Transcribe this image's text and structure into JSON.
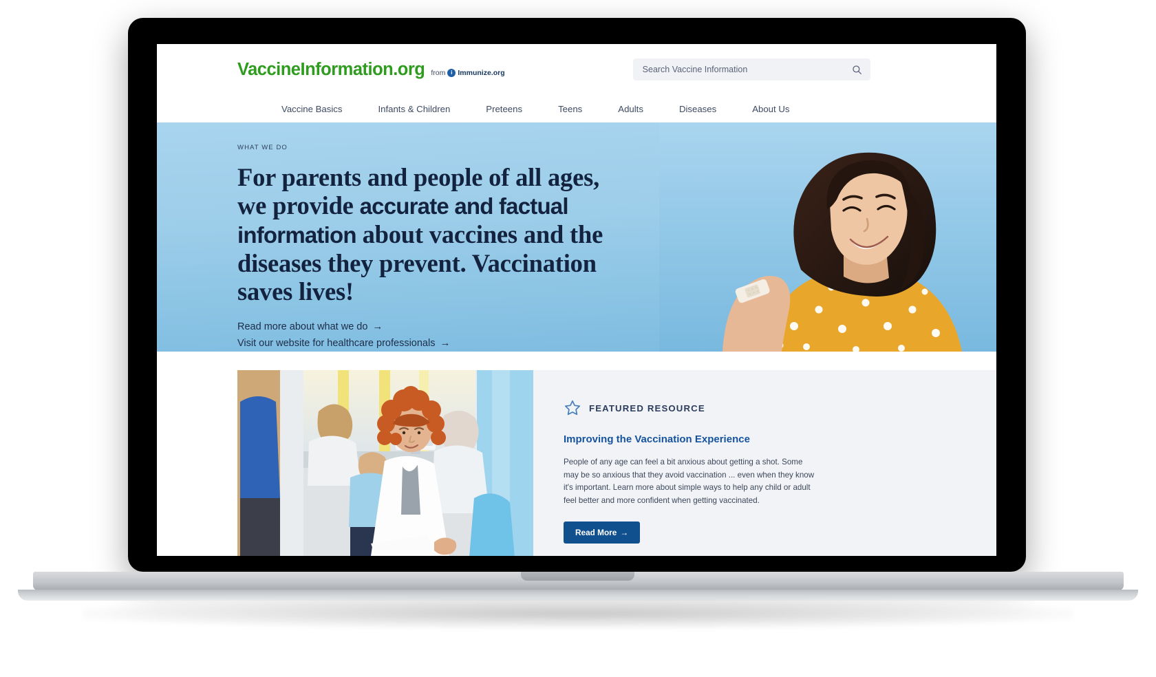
{
  "header": {
    "brand_name": "VaccineInformation.org",
    "from_label": "from",
    "immunize_mark": "i",
    "immunize_name": "Immunize.org",
    "search_placeholder": "Search Vaccine Information",
    "search_value": "",
    "search_icon": "search-icon"
  },
  "nav": {
    "items": [
      {
        "label": "Vaccine Basics"
      },
      {
        "label": "Infants & Children"
      },
      {
        "label": "Preteens"
      },
      {
        "label": "Teens"
      },
      {
        "label": "Adults"
      },
      {
        "label": "Diseases"
      },
      {
        "label": "About Us"
      }
    ]
  },
  "hero": {
    "eyebrow": "WHAT WE DO",
    "head_part1": "For parents and people of all ages, we provide ",
    "head_bold": "accurate and factual information",
    "head_part2": " about vaccines and the diseases they prevent. Vaccination saves lives!",
    "links": [
      {
        "label": "Read more about what we do",
        "arrow": "→"
      },
      {
        "label": "Visit our website for healthcare professionals",
        "arrow": "→"
      }
    ],
    "image_alt": "Smiling woman in orange polka-dot top with bandage on her upper arm",
    "bg_color": "#9ccde9"
  },
  "featured": {
    "kicker": "FEATURED RESOURCE",
    "kicker_icon": "star-outline-icon",
    "title": "Improving the Vaccination Experience",
    "description": "People of any age can feel a bit anxious about getting a shot. Some may be so anxious that they avoid vaccination ... even when they know it's important. Learn more about simple ways to help any child or adult feel better and more confident when getting vaccinated.",
    "button_label": "Read More",
    "button_arrow": "→",
    "button_color": "#11508f",
    "title_color": "#15539e",
    "image_alt": "Healthcare worker with curly red hair in a white coat talking with a patient in a clinic waiting room"
  }
}
